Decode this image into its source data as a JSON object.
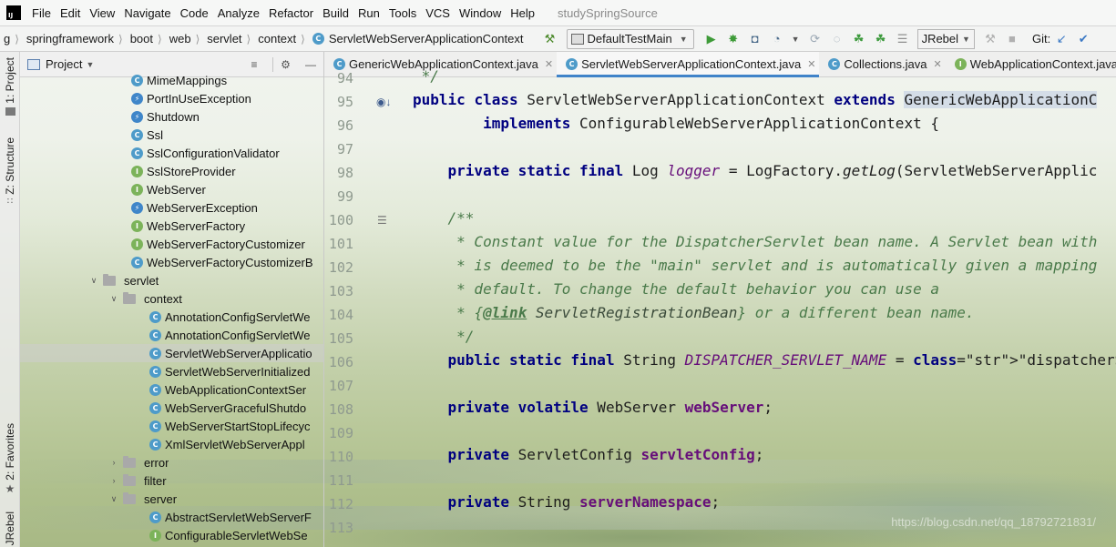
{
  "menu": {
    "items": [
      "File",
      "Edit",
      "View",
      "Navigate",
      "Code",
      "Analyze",
      "Refactor",
      "Build",
      "Run",
      "Tools",
      "VCS",
      "Window",
      "Help"
    ],
    "project_title": "studySpringSource"
  },
  "breadcrumb": [
    "g",
    "springframework",
    "boot",
    "web",
    "servlet",
    "context",
    "ServletWebServerApplicationContext"
  ],
  "toolbar": {
    "run_config": "DefaultTestMain",
    "jrebel": "JRebel",
    "git_label": "Git:"
  },
  "left_stripe": {
    "project": "1: Project",
    "structure": "Z: Structure",
    "favorites": "2: Favorites",
    "jrebel": "JRebel"
  },
  "project_panel": {
    "title": "Project",
    "rows": [
      {
        "label": "MimeMappings",
        "kind": "class",
        "indent": 144
      },
      {
        "label": "PortInUseException",
        "kind": "exception",
        "indent": 144
      },
      {
        "label": "Shutdown",
        "kind": "exception",
        "indent": 144
      },
      {
        "label": "Ssl",
        "kind": "class",
        "indent": 144
      },
      {
        "label": "SslConfigurationValidator",
        "kind": "class",
        "indent": 144
      },
      {
        "label": "SslStoreProvider",
        "kind": "interface",
        "indent": 144
      },
      {
        "label": "WebServer",
        "kind": "interface",
        "indent": 144
      },
      {
        "label": "WebServerException",
        "kind": "exception",
        "indent": 144
      },
      {
        "label": "WebServerFactory",
        "kind": "interface",
        "indent": 144
      },
      {
        "label": "WebServerFactoryCustomizer",
        "kind": "interface",
        "indent": 144
      },
      {
        "label": "WebServerFactoryCustomizerB",
        "kind": "class",
        "indent": 144
      },
      {
        "label": "servlet",
        "kind": "folder",
        "indent": 100,
        "arrow": "v"
      },
      {
        "label": "context",
        "kind": "folder",
        "indent": 122,
        "arrow": "v"
      },
      {
        "label": "AnnotationConfigServletWe",
        "kind": "class",
        "indent": 164
      },
      {
        "label": "AnnotationConfigServletWe",
        "kind": "class",
        "indent": 164
      },
      {
        "label": "ServletWebServerApplicatio",
        "kind": "class",
        "indent": 164,
        "selected": true
      },
      {
        "label": "ServletWebServerInitialized",
        "kind": "class",
        "indent": 164
      },
      {
        "label": "WebApplicationContextSer",
        "kind": "class",
        "indent": 164
      },
      {
        "label": "WebServerGracefulShutdo",
        "kind": "class",
        "indent": 164
      },
      {
        "label": "WebServerStartStopLifecyc",
        "kind": "class",
        "indent": 164
      },
      {
        "label": "XmlServletWebServerAppl",
        "kind": "class",
        "indent": 164
      },
      {
        "label": "error",
        "kind": "folder",
        "indent": 122,
        "arrow": ">"
      },
      {
        "label": "filter",
        "kind": "folder",
        "indent": 122,
        "arrow": ">"
      },
      {
        "label": "server",
        "kind": "folder",
        "indent": 122,
        "arrow": "v"
      },
      {
        "label": "AbstractServletWebServerF",
        "kind": "class",
        "indent": 164
      },
      {
        "label": "ConfigurableServletWebSe",
        "kind": "interface",
        "indent": 164
      }
    ]
  },
  "editor": {
    "tabs": [
      {
        "label": "GenericWebApplicationContext.java",
        "kind": "class",
        "active": false
      },
      {
        "label": "ServletWebServerApplicationContext.java",
        "kind": "class",
        "active": true
      },
      {
        "label": "Collections.java",
        "kind": "class",
        "active": false
      },
      {
        "label": "WebApplicationContext.java",
        "kind": "interface",
        "active": false
      }
    ],
    "lines": [
      {
        "n": "94",
        "text": " */"
      },
      {
        "n": "95",
        "text": "public class ServletWebServerApplicationContext extends GenericWebApplicationC"
      },
      {
        "n": "96",
        "text": "        implements ConfigurableWebServerApplicationContext {"
      },
      {
        "n": "97",
        "text": ""
      },
      {
        "n": "98",
        "text": "    private static final Log logger = LogFactory.getLog(ServletWebServerApplic"
      },
      {
        "n": "99",
        "text": ""
      },
      {
        "n": "100",
        "text": "    /**"
      },
      {
        "n": "101",
        "text": "     * Constant value for the DispatcherServlet bean name. A Servlet bean with"
      },
      {
        "n": "102",
        "text": "     * is deemed to be the \"main\" servlet and is automatically given a mapping"
      },
      {
        "n": "103",
        "text": "     * default. To change the default behavior you can use a"
      },
      {
        "n": "104",
        "text": "     * {@link ServletRegistrationBean} or a different bean name."
      },
      {
        "n": "105",
        "text": "     */"
      },
      {
        "n": "106",
        "text": "    public static final String DISPATCHER_SERVLET_NAME = \"dispatcherServlet\";"
      },
      {
        "n": "107",
        "text": ""
      },
      {
        "n": "108",
        "text": "    private volatile WebServer webServer;"
      },
      {
        "n": "109",
        "text": ""
      },
      {
        "n": "110",
        "text": "    private ServletConfig servletConfig;"
      },
      {
        "n": "111",
        "text": ""
      },
      {
        "n": "112",
        "text": "    private String serverNamespace;"
      },
      {
        "n": "113",
        "text": ""
      }
    ]
  },
  "watermark": "https://blog.csdn.net/qq_18792721831/",
  "colors": {
    "keyword": "#000080",
    "field": "#660e7a",
    "string": "#067d17",
    "doc_comment": "#4a7a4a",
    "accent": "#4083c9"
  }
}
